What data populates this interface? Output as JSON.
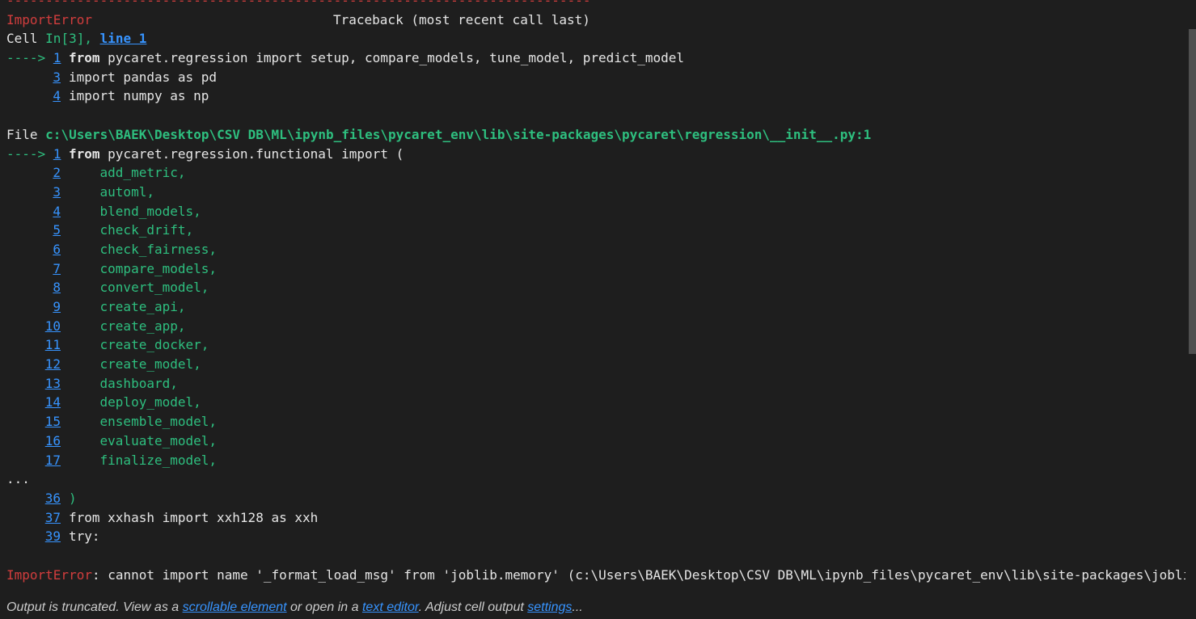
{
  "output": {
    "dashes": "---------------------------------------------------------------------------",
    "error_name": "ImportError",
    "traceback_header": "Traceback (most recent call last)",
    "cell_prefix": "Cell ",
    "cell_ref": "In[3], ",
    "cell_line_link": "line 1",
    "arrow": "---->",
    "frame1": {
      "lines": [
        {
          "num": "1",
          "arrow": true,
          "kw": "from",
          "code": " pycaret.regression import setup, compare_models, tune_model, predict_model"
        },
        {
          "num": "3",
          "arrow": false,
          "kw": "",
          "code": "import pandas as pd"
        },
        {
          "num": "4",
          "arrow": false,
          "kw": "",
          "code": "import numpy as np"
        }
      ]
    },
    "file_prefix": "File ",
    "file_path": "c:\\Users\\BAEK\\Desktop\\CSV DB\\ML\\ipynb_files\\pycaret_env\\lib\\site-packages\\pycaret\\regression\\__init__.py:1",
    "frame2": {
      "first": {
        "num": "1",
        "kw": "from",
        "code": " pycaret.regression.functional import ("
      },
      "args": [
        {
          "num": "2",
          "code": "add_metric,"
        },
        {
          "num": "3",
          "code": "automl,"
        },
        {
          "num": "4",
          "code": "blend_models,"
        },
        {
          "num": "5",
          "code": "check_drift,"
        },
        {
          "num": "6",
          "code": "check_fairness,"
        },
        {
          "num": "7",
          "code": "compare_models,"
        },
        {
          "num": "8",
          "code": "convert_model,"
        },
        {
          "num": "9",
          "code": "create_api,"
        },
        {
          "num": "10",
          "code": "create_app,"
        },
        {
          "num": "11",
          "code": "create_docker,"
        },
        {
          "num": "12",
          "code": "create_model,"
        },
        {
          "num": "13",
          "code": "dashboard,"
        },
        {
          "num": "14",
          "code": "deploy_model,"
        },
        {
          "num": "15",
          "code": "ensemble_model,"
        },
        {
          "num": "16",
          "code": "evaluate_model,"
        },
        {
          "num": "17",
          "code": "finalize_model,"
        }
      ],
      "ellipsis": "...",
      "tail": [
        {
          "num": "36",
          "code": ")",
          "color": "green"
        },
        {
          "num": "37",
          "code": "from xxhash import xxh128 as xxh",
          "color": "white"
        },
        {
          "num": "39",
          "code": "try:",
          "color": "white"
        }
      ]
    },
    "final_error_name": "ImportError",
    "final_error_msg": ": cannot import name '_format_load_msg' from 'joblib.memory' (c:\\Users\\BAEK\\Desktop\\CSV DB\\ML\\ipynb_files\\pycaret_env\\lib\\site-packages\\joblib\\memory.py)"
  },
  "footer": {
    "part1": "Output is truncated. View as a ",
    "link_scrollable": "scrollable element",
    "part2": " or open in a ",
    "link_editor": "text editor",
    "part3": ". Adjust cell output ",
    "link_settings": "settings",
    "part4": "..."
  },
  "colors": {
    "background": "#1e1e1e",
    "error_red": "#d13d3d",
    "green": "#2ebf7f",
    "link_blue": "#3794ff"
  }
}
